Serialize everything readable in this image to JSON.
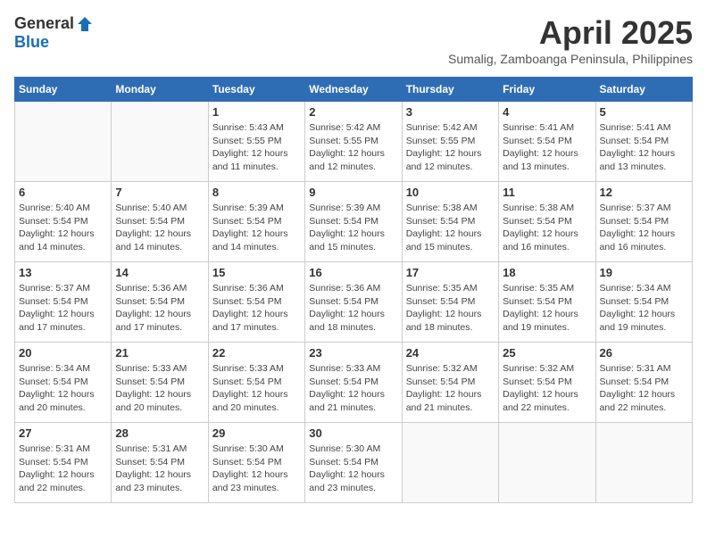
{
  "header": {
    "logo_general": "General",
    "logo_blue": "Blue",
    "month_title": "April 2025",
    "location": "Sumalig, Zamboanga Peninsula, Philippines"
  },
  "days_of_week": [
    "Sunday",
    "Monday",
    "Tuesday",
    "Wednesday",
    "Thursday",
    "Friday",
    "Saturday"
  ],
  "weeks": [
    [
      {
        "day": "",
        "info": ""
      },
      {
        "day": "",
        "info": ""
      },
      {
        "day": "1",
        "info": "Sunrise: 5:43 AM\nSunset: 5:55 PM\nDaylight: 12 hours\nand 11 minutes."
      },
      {
        "day": "2",
        "info": "Sunrise: 5:42 AM\nSunset: 5:55 PM\nDaylight: 12 hours\nand 12 minutes."
      },
      {
        "day": "3",
        "info": "Sunrise: 5:42 AM\nSunset: 5:55 PM\nDaylight: 12 hours\nand 12 minutes."
      },
      {
        "day": "4",
        "info": "Sunrise: 5:41 AM\nSunset: 5:54 PM\nDaylight: 12 hours\nand 13 minutes."
      },
      {
        "day": "5",
        "info": "Sunrise: 5:41 AM\nSunset: 5:54 PM\nDaylight: 12 hours\nand 13 minutes."
      }
    ],
    [
      {
        "day": "6",
        "info": "Sunrise: 5:40 AM\nSunset: 5:54 PM\nDaylight: 12 hours\nand 14 minutes."
      },
      {
        "day": "7",
        "info": "Sunrise: 5:40 AM\nSunset: 5:54 PM\nDaylight: 12 hours\nand 14 minutes."
      },
      {
        "day": "8",
        "info": "Sunrise: 5:39 AM\nSunset: 5:54 PM\nDaylight: 12 hours\nand 14 minutes."
      },
      {
        "day": "9",
        "info": "Sunrise: 5:39 AM\nSunset: 5:54 PM\nDaylight: 12 hours\nand 15 minutes."
      },
      {
        "day": "10",
        "info": "Sunrise: 5:38 AM\nSunset: 5:54 PM\nDaylight: 12 hours\nand 15 minutes."
      },
      {
        "day": "11",
        "info": "Sunrise: 5:38 AM\nSunset: 5:54 PM\nDaylight: 12 hours\nand 16 minutes."
      },
      {
        "day": "12",
        "info": "Sunrise: 5:37 AM\nSunset: 5:54 PM\nDaylight: 12 hours\nand 16 minutes."
      }
    ],
    [
      {
        "day": "13",
        "info": "Sunrise: 5:37 AM\nSunset: 5:54 PM\nDaylight: 12 hours\nand 17 minutes."
      },
      {
        "day": "14",
        "info": "Sunrise: 5:36 AM\nSunset: 5:54 PM\nDaylight: 12 hours\nand 17 minutes."
      },
      {
        "day": "15",
        "info": "Sunrise: 5:36 AM\nSunset: 5:54 PM\nDaylight: 12 hours\nand 17 minutes."
      },
      {
        "day": "16",
        "info": "Sunrise: 5:36 AM\nSunset: 5:54 PM\nDaylight: 12 hours\nand 18 minutes."
      },
      {
        "day": "17",
        "info": "Sunrise: 5:35 AM\nSunset: 5:54 PM\nDaylight: 12 hours\nand 18 minutes."
      },
      {
        "day": "18",
        "info": "Sunrise: 5:35 AM\nSunset: 5:54 PM\nDaylight: 12 hours\nand 19 minutes."
      },
      {
        "day": "19",
        "info": "Sunrise: 5:34 AM\nSunset: 5:54 PM\nDaylight: 12 hours\nand 19 minutes."
      }
    ],
    [
      {
        "day": "20",
        "info": "Sunrise: 5:34 AM\nSunset: 5:54 PM\nDaylight: 12 hours\nand 20 minutes."
      },
      {
        "day": "21",
        "info": "Sunrise: 5:33 AM\nSunset: 5:54 PM\nDaylight: 12 hours\nand 20 minutes."
      },
      {
        "day": "22",
        "info": "Sunrise: 5:33 AM\nSunset: 5:54 PM\nDaylight: 12 hours\nand 20 minutes."
      },
      {
        "day": "23",
        "info": "Sunrise: 5:33 AM\nSunset: 5:54 PM\nDaylight: 12 hours\nand 21 minutes."
      },
      {
        "day": "24",
        "info": "Sunrise: 5:32 AM\nSunset: 5:54 PM\nDaylight: 12 hours\nand 21 minutes."
      },
      {
        "day": "25",
        "info": "Sunrise: 5:32 AM\nSunset: 5:54 PM\nDaylight: 12 hours\nand 22 minutes."
      },
      {
        "day": "26",
        "info": "Sunrise: 5:31 AM\nSunset: 5:54 PM\nDaylight: 12 hours\nand 22 minutes."
      }
    ],
    [
      {
        "day": "27",
        "info": "Sunrise: 5:31 AM\nSunset: 5:54 PM\nDaylight: 12 hours\nand 22 minutes."
      },
      {
        "day": "28",
        "info": "Sunrise: 5:31 AM\nSunset: 5:54 PM\nDaylight: 12 hours\nand 23 minutes."
      },
      {
        "day": "29",
        "info": "Sunrise: 5:30 AM\nSunset: 5:54 PM\nDaylight: 12 hours\nand 23 minutes."
      },
      {
        "day": "30",
        "info": "Sunrise: 5:30 AM\nSunset: 5:54 PM\nDaylight: 12 hours\nand 23 minutes."
      },
      {
        "day": "",
        "info": ""
      },
      {
        "day": "",
        "info": ""
      },
      {
        "day": "",
        "info": ""
      }
    ]
  ]
}
